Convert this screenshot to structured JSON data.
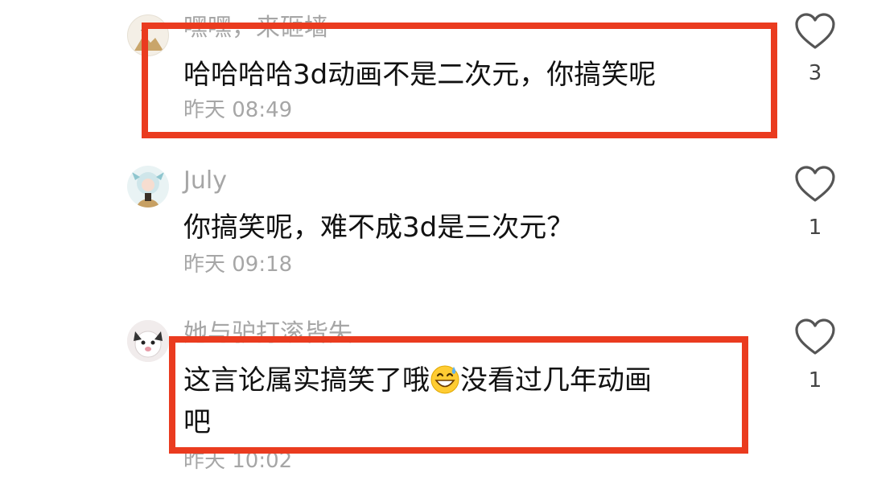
{
  "colors": {
    "highlight": "#ea3b1f",
    "meta_text": "#a6a6a6",
    "body_text": "#111111"
  },
  "comments": [
    {
      "username": "嘿嘿，来砸墙",
      "text": "哈哈哈哈3d动画不是二次元，你搞笑呢",
      "time": "昨天 08:49",
      "likes": "3",
      "highlighted": true
    },
    {
      "username": "July",
      "text": "你搞笑呢，难不成3d是三次元？",
      "time": "昨天 09:18",
      "likes": "1",
      "highlighted": false
    },
    {
      "username": "她与驴打滚皆失",
      "text_line1_before_emoji": "这言论属实搞笑了哦",
      "emoji": "grinning-sweat-emoji",
      "text_line1_after_emoji": "没看过几年动画",
      "text_line2": "吧",
      "time": "昨天 10:02",
      "likes": "1",
      "highlighted": true
    }
  ]
}
